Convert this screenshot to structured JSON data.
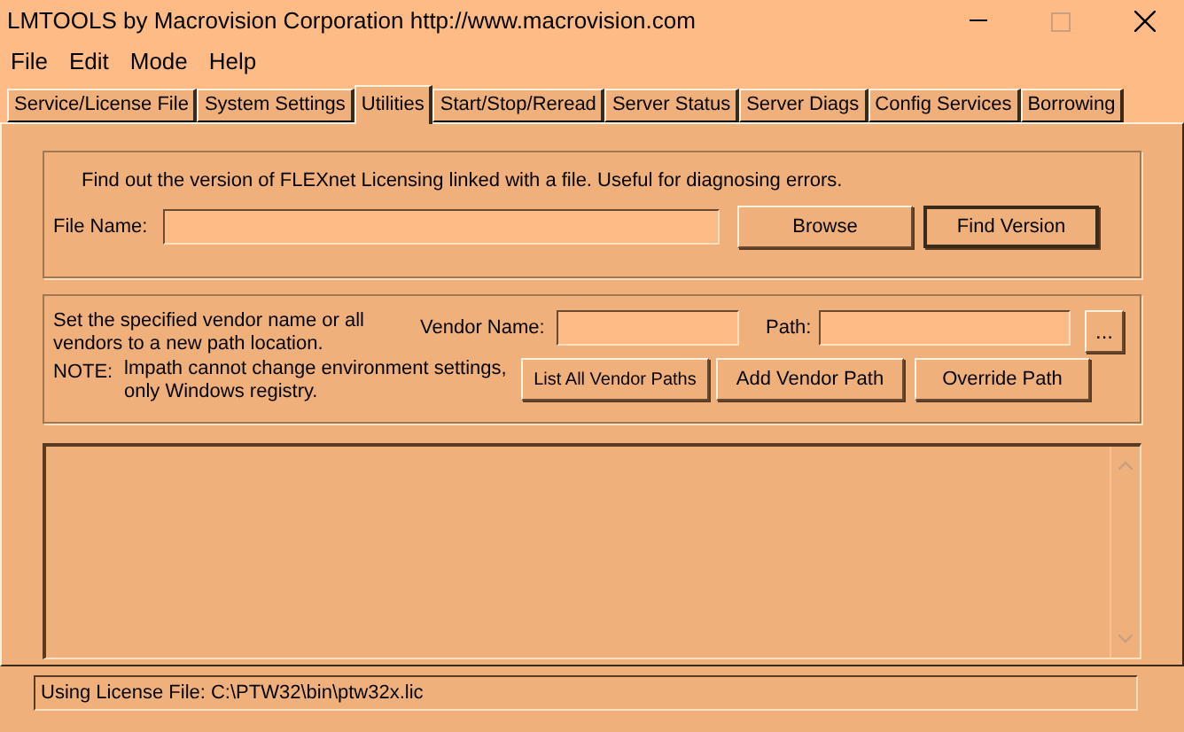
{
  "window": {
    "title": "LMTOOLS by Macrovision Corporation http://www.macrovision.com"
  },
  "menu": [
    "File",
    "Edit",
    "Mode",
    "Help"
  ],
  "tabs": [
    {
      "label": "Service/License File",
      "selected": false
    },
    {
      "label": "System Settings",
      "selected": false
    },
    {
      "label": "Utilities",
      "selected": true
    },
    {
      "label": "Start/Stop/Reread",
      "selected": false
    },
    {
      "label": "Server Status",
      "selected": false
    },
    {
      "label": "Server Diags",
      "selected": false
    },
    {
      "label": "Config Services",
      "selected": false
    },
    {
      "label": "Borrowing",
      "selected": false
    }
  ],
  "version_group": {
    "description": "Find out the version of FLEXnet Licensing linked with a file.  Useful for diagnosing errors.",
    "file_name_label": "File Name:",
    "buttons": [
      {
        "label": "Browse",
        "default": false
      },
      {
        "label": "Find Version",
        "default": true
      }
    ]
  },
  "vendor_group": {
    "description": "Set the specified vendor name or all vendors to a new path location.",
    "vendor_name_label": "Vendor Name:",
    "path_label": "Path:",
    "browse_button": "...",
    "note_label": "NOTE:",
    "note": "lmpath cannot change environment settings, only Windows registry.",
    "buttons": [
      {
        "label": "List All Vendor Paths",
        "default": false
      },
      {
        "label": "Add Vendor Path",
        "default": false
      },
      {
        "label": "Override Path",
        "default": false
      }
    ]
  },
  "status_bar": {
    "text": "Using License File:  C:\\PTW32\\bin\\ptw32x.lic"
  }
}
